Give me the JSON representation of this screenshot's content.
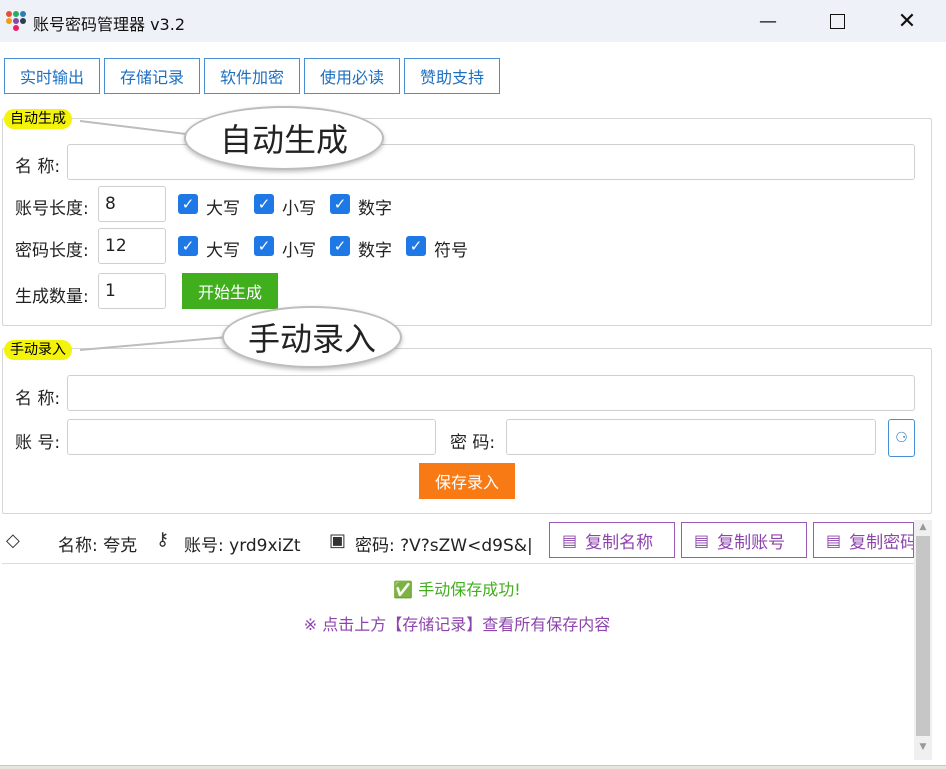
{
  "window": {
    "title": "账号密码管理器 v3.2"
  },
  "colors": {
    "accent_blue": "#1e78e6",
    "green": "#41ae1e",
    "orange": "#f77a14",
    "purple": "#8e44ad",
    "highlight_yellow": "#f4f40a"
  },
  "tabs": [
    {
      "label": "实时输出"
    },
    {
      "label": "存储记录"
    },
    {
      "label": "软件加密"
    },
    {
      "label": "使用必读"
    },
    {
      "label": "赞助支持"
    }
  ],
  "auto": {
    "group_label": "自动生成",
    "callout": "自动生成",
    "name_label": "名 称:",
    "name_value": "",
    "account_length_label": "账号长度:",
    "account_length_value": "8",
    "account_options": [
      {
        "label": "大写",
        "checked": true
      },
      {
        "label": "小写",
        "checked": true
      },
      {
        "label": "数字",
        "checked": true
      }
    ],
    "password_length_label": "密码长度:",
    "password_length_value": "12",
    "password_options": [
      {
        "label": "大写",
        "checked": true
      },
      {
        "label": "小写",
        "checked": true
      },
      {
        "label": "数字",
        "checked": true
      },
      {
        "label": "符号",
        "checked": true
      }
    ],
    "count_label": "生成数量:",
    "count_value": "1",
    "generate_button": "开始生成"
  },
  "manual": {
    "group_label": "手动录入",
    "callout": "手动录入",
    "name_label": "名 称:",
    "name_value": "",
    "account_label": "账 号:",
    "account_value": "",
    "password_label": "密 码:",
    "password_value": "",
    "save_button": "保存录入"
  },
  "info": {
    "name_text": "名称: 夸克",
    "account_text": "账号: yrd9xiZt",
    "password_text": "密码: ?V?sZW<d9S&|",
    "copy_name": "复制名称",
    "copy_account": "复制账号",
    "copy_password": "复制密码"
  },
  "status": {
    "success": "✅ 手动保存成功!",
    "hint": "※ 点击上方【存储记录】查看所有保存内容"
  },
  "icons": [
    "app-icon",
    "minimize-icon",
    "maximize-icon",
    "close-icon",
    "tag-icon",
    "key-icon",
    "lock-icon",
    "clipboard-icon",
    "dice-icon",
    "check-icon"
  ]
}
